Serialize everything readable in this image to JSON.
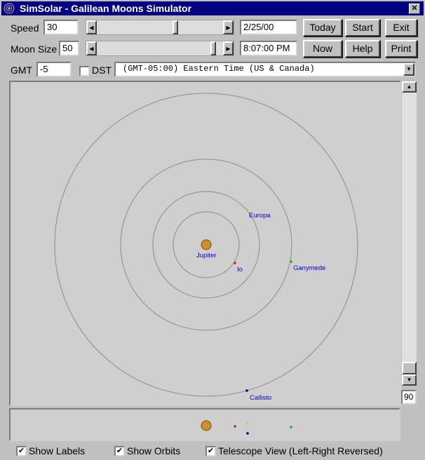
{
  "window": {
    "title": "SimSolar - Galilean Moons Simulator",
    "close_glyph": "✕"
  },
  "controls": {
    "speed_label": "Speed",
    "speed_value": "30",
    "moonsize_label": "Moon Size",
    "moonsize_value": "50",
    "speed_slider_level": 0.62,
    "moonsize_slider_level": 0.93,
    "date": "2/25/00",
    "time": "8:07:00 PM",
    "gmt_label": "GMT",
    "gmt_value": "-5",
    "dst_label": "DST",
    "dst_checked": false,
    "timezone": "(GMT-05:00) Eastern Time (US & Canada)"
  },
  "buttons": {
    "today": "Today",
    "start": "Start",
    "exit": "Exit",
    "now": "Now",
    "help": "Help",
    "print": "Print"
  },
  "sim": {
    "zoom_value": "90",
    "bodies": [
      {
        "name": "Jupiter",
        "color": "#d08f2e"
      },
      {
        "name": "Io",
        "color": "#cc2222"
      },
      {
        "name": "Europa",
        "color": "#cccc33"
      },
      {
        "name": "Ganymede",
        "color": "#22aa22"
      },
      {
        "name": "Callisto",
        "color": "#000080"
      }
    ],
    "label_color": "#0000cc"
  },
  "options": {
    "show_labels": "Show Labels",
    "show_labels_checked": true,
    "show_orbits": "Show Orbits",
    "show_orbits_checked": true,
    "telescope": "Telescope View (Left-Right Reversed)",
    "telescope_checked": true
  },
  "icons": {
    "scroll_left": "◀",
    "scroll_right": "▶",
    "scroll_up": "▲",
    "scroll_down": "▼",
    "dropdown": "▼",
    "check": "✔"
  }
}
